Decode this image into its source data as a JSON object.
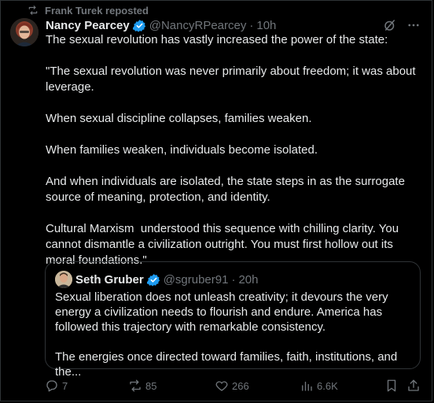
{
  "repost": {
    "text": "Frank Turek reposted"
  },
  "post": {
    "author_name": "Nancy Pearcey",
    "handle": "@NancyRPearcey",
    "separator": "·",
    "time": "10h",
    "text": "The sexual revolution has vastly increased the power of the state:\n\n\"The sexual revolution was never primarily about freedom; it was about leverage.\n\nWhen sexual discipline collapses, families weaken.\n\nWhen families weaken, individuals become isolated.\n\nAnd when individuals are isolated, the state steps in as the surrogate source of meaning, protection, and identity.\n\nCultural Marxism  understood this sequence with chilling clarity. You cannot dismantle a civilization outright. You must first hollow out its moral foundations.\""
  },
  "quote": {
    "author_name": "Seth Gruber",
    "handle": "@sgruber91",
    "separator": "·",
    "time": "20h",
    "text": "Sexual liberation does not unleash creativity; it devours the very energy a civilization needs to flourish and endure. America has followed this trajectory with remarkable consistency.\n\nThe energies once directed toward families, faith, institutions, and the..."
  },
  "actions": {
    "replies": "7",
    "reposts": "85",
    "likes": "266",
    "views": "6.6K"
  },
  "colors": {
    "background": "#000000",
    "text": "#e7e9ea",
    "muted": "#71767b",
    "border": "#2f3336",
    "verified": "#1d9bf0"
  }
}
